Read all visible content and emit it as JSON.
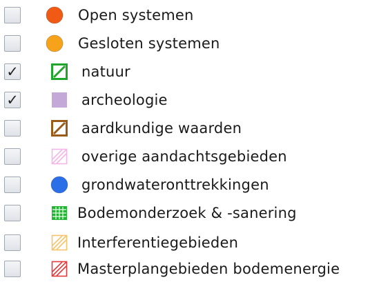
{
  "layers": [
    {
      "label": "Open systemen",
      "checked": false,
      "icon": "filled-circle-icon",
      "color": "#f05a14",
      "style": "circle"
    },
    {
      "label": "Gesloten systemen",
      "checked": false,
      "icon": "filled-circle-icon",
      "color": "#f7a21b",
      "style": "circle"
    },
    {
      "label": "natuur",
      "checked": true,
      "icon": "hatched-square-icon",
      "color": "#1fa62a",
      "style": "hatch"
    },
    {
      "label": "archeologie",
      "checked": true,
      "icon": "filled-square-icon",
      "color": "#c3a8d8",
      "style": "fill"
    },
    {
      "label": "aardkundige waarden",
      "checked": false,
      "icon": "hatched-square-icon",
      "color": "#9a5a18",
      "style": "hatch"
    },
    {
      "label": "overige aandachtsgebieden",
      "checked": false,
      "icon": "hatched-square-icon",
      "color": "#f4b6e8",
      "style": "hatch-light"
    },
    {
      "label": "grondwateronttrekkingen",
      "checked": false,
      "icon": "filled-circle-icon",
      "color": "#2a6ee8",
      "style": "circle"
    },
    {
      "label": "Bodemonderzoek & -sanering",
      "checked": false,
      "icon": "grid-square-icon",
      "color": "#22b433",
      "style": "grid"
    },
    {
      "label": "Interferentiegebieden",
      "checked": false,
      "icon": "hatched-square-icon",
      "color": "#f4c46a",
      "style": "hatch-light"
    },
    {
      "label": "Masterplangebieden bodemenergie",
      "checked": false,
      "icon": "hatched-square-icon",
      "color": "#e23a3a",
      "style": "hatch-light"
    }
  ],
  "check_glyph": "✓"
}
